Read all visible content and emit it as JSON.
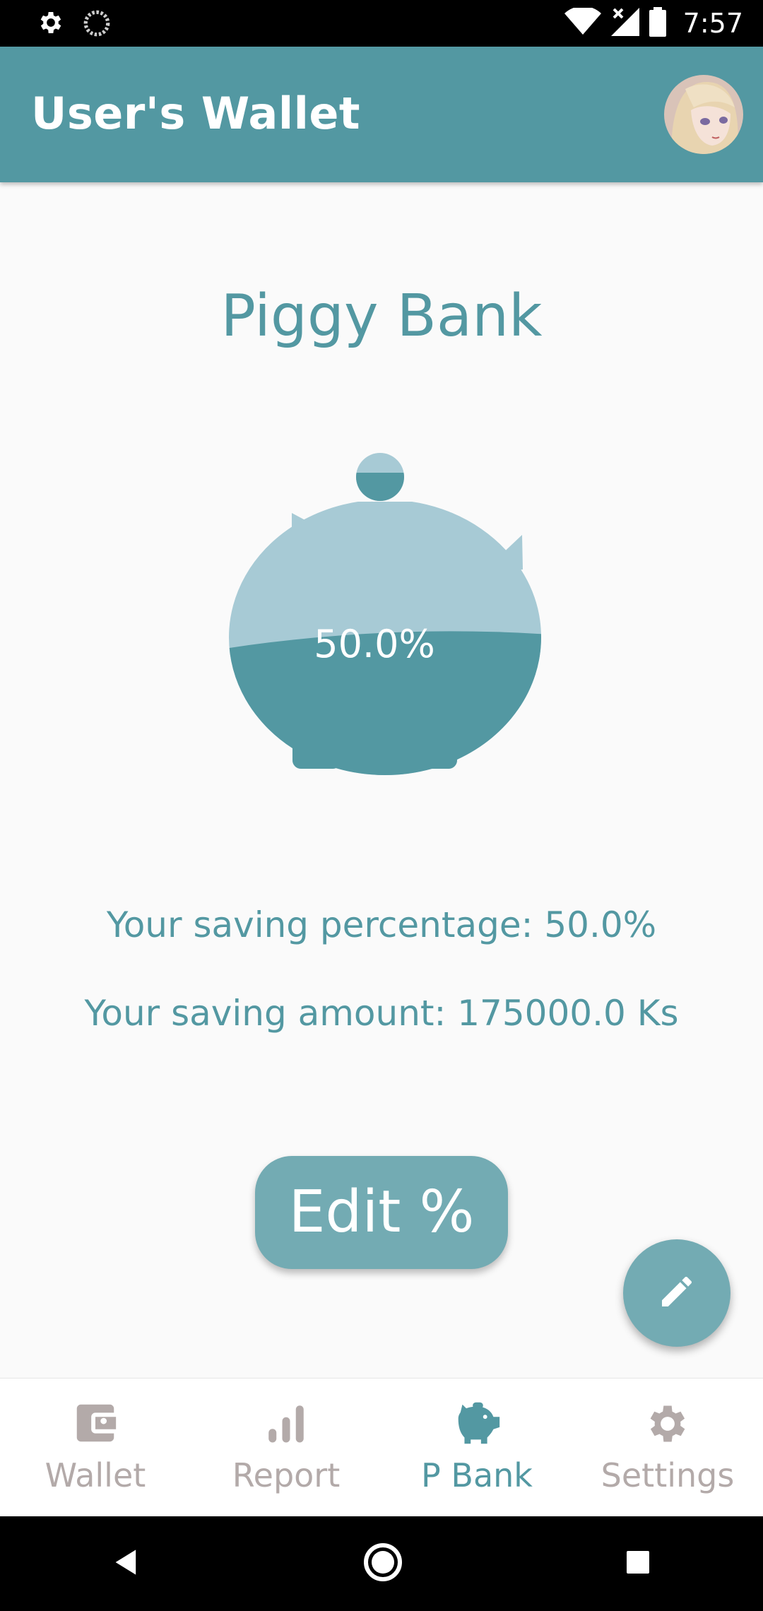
{
  "status_bar": {
    "time": "7:57",
    "icons": [
      "settings-gear-icon",
      "sync-icon",
      "wifi-icon",
      "signal-no-data-icon",
      "battery-icon"
    ]
  },
  "app_bar": {
    "title": "User's Wallet",
    "avatar": "user-avatar"
  },
  "main": {
    "heading": "Piggy Bank",
    "pig_fill_fraction": 0.5,
    "pig_percent_label": "50.0%",
    "saving_percentage_text": "Your saving percentage: 50.0%",
    "saving_amount_text": "Your saving amount: 175000.0 Ks",
    "edit_button_label": "Edit %",
    "fab_icon": "pencil-icon"
  },
  "bottom_nav": {
    "items": [
      {
        "label": "Wallet",
        "icon": "wallet-icon",
        "active": false
      },
      {
        "label": "Report",
        "icon": "bar-chart-icon",
        "active": false
      },
      {
        "label": "P Bank",
        "icon": "piggy-bank-icon",
        "active": true
      },
      {
        "label": "Settings",
        "icon": "settings-gear-icon",
        "active": false
      }
    ]
  },
  "colors": {
    "primary": "#5398a2",
    "primary_light": "#a7cad5",
    "button": "#73abb3",
    "inactive": "#b3aaa9",
    "background": "#fafafa"
  }
}
